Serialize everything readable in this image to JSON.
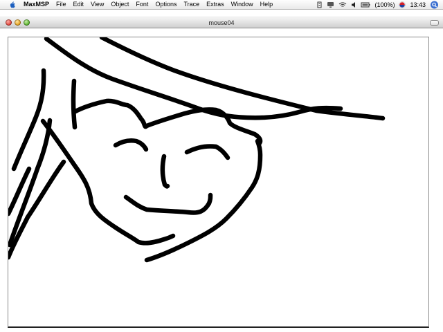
{
  "menubar": {
    "apple_icon": "apple-logo-icon",
    "app_name": "MaxMSP",
    "items": [
      "File",
      "Edit",
      "View",
      "Object",
      "Font",
      "Options",
      "Trace",
      "Extras",
      "Window",
      "Help"
    ]
  },
  "status": {
    "icons": [
      "script-menu-icon",
      "display-icon",
      "wifi-icon",
      "volume-icon",
      "battery-icon",
      "input-flag-icon"
    ],
    "battery_label": "(100%)",
    "clock": "13:43",
    "spotlight_icon": "spotlight-search-icon"
  },
  "window": {
    "title": "mouse04",
    "controls": [
      "close-button",
      "minimize-button",
      "zoom-button"
    ],
    "stroke_color": "#000000",
    "background_color": "#ffffff"
  }
}
